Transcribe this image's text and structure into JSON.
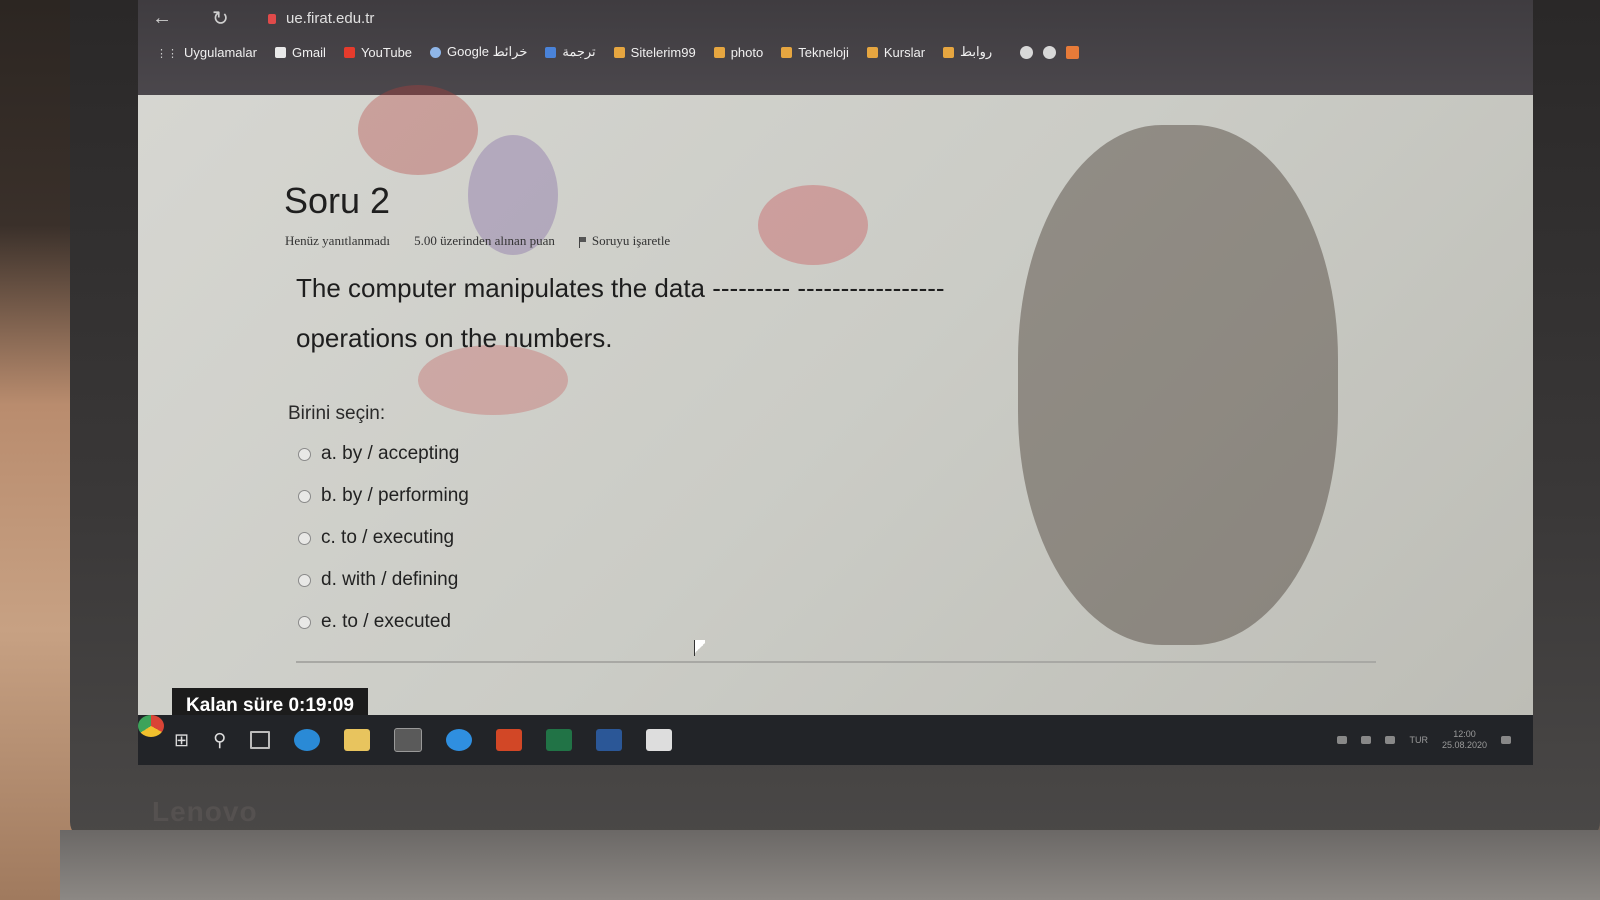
{
  "browser": {
    "url": "ue.firat.edu.tr",
    "bookmarks": [
      {
        "label": "Uygulamalar",
        "icon": "apps-icon"
      },
      {
        "label": "Gmail",
        "icon": "gmail-icon"
      },
      {
        "label": "YouTube",
        "icon": "youtube-icon"
      },
      {
        "label": "Google خرائط",
        "icon": "google-maps-icon"
      },
      {
        "label": "ترجمة",
        "icon": "translate-icon"
      },
      {
        "label": "Sitelerim99",
        "icon": "folder-icon"
      },
      {
        "label": "photo",
        "icon": "folder-icon"
      },
      {
        "label": "Tekneloji",
        "icon": "folder-icon"
      },
      {
        "label": "Kurslar",
        "icon": "folder-icon"
      },
      {
        "label": "روابط",
        "icon": "folder-icon"
      }
    ]
  },
  "question": {
    "title": "Soru 2",
    "status": "Henüz yanıtlanmadı",
    "points": "5.00 üzerinden alınan puan",
    "flag_label": "Soruyu işaretle",
    "text_line1": "The computer manipulates the data ---------      -----------------",
    "text_line2": "operations on the numbers.",
    "prompt": "Birini seçin:",
    "answers": [
      "a. by / accepting",
      "b. by / performing",
      "c. to / executing",
      "d. with / defining",
      "e. to / executed"
    ]
  },
  "timer": {
    "label": "Kalan süre",
    "value": "0:19:09"
  },
  "taskbar": {
    "tray_lang": "TUR",
    "clock_time": "12:00",
    "clock_date": "25.08.2020"
  },
  "device": {
    "brand": "Lenovo"
  }
}
